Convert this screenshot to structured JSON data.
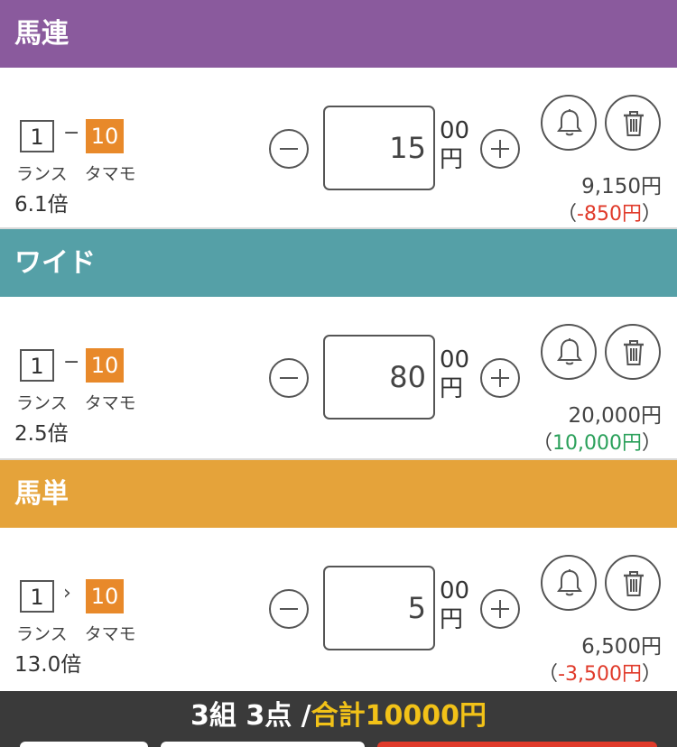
{
  "colors": {
    "umaren": "#8a5a9d",
    "wide": "#55a0a7",
    "umatan": "#e5a33a",
    "gain": "#2aa05a",
    "loss": "#e03a2a",
    "accent": "#e8892a",
    "total": "#f2c218"
  },
  "sections": [
    {
      "header": "馬連",
      "horse1": "1",
      "connector": "−",
      "horse2": "10",
      "names": "ランス　タマモ",
      "odds": "6.1倍",
      "amount": "15",
      "unit_top": "00",
      "unit_bottom": "円",
      "payout": "9,150円",
      "diff_open": "（",
      "diff_value": "-850円",
      "diff_close": "）"
    },
    {
      "header": "ワイド",
      "horse1": "1",
      "connector": "−",
      "horse2": "10",
      "names": "ランス　タマモ",
      "odds": "2.5倍",
      "amount": "80",
      "unit_top": "00",
      "unit_bottom": "円",
      "payout": "20,000円",
      "diff_open": "（",
      "diff_value": "10,000円",
      "diff_close": "）"
    },
    {
      "header": "馬単",
      "horse1": "1",
      "connector": "›",
      "horse2": "10",
      "names": "ランス　タマモ",
      "odds": "13.0倍",
      "amount": "5",
      "unit_top": "00",
      "unit_bottom": "円",
      "payout": "6,500円",
      "diff_open": "（",
      "diff_value": "-3,500円",
      "diff_close": "）"
    }
  ],
  "footer": {
    "count": "3組 3点 /",
    "total": "合計10000円"
  }
}
